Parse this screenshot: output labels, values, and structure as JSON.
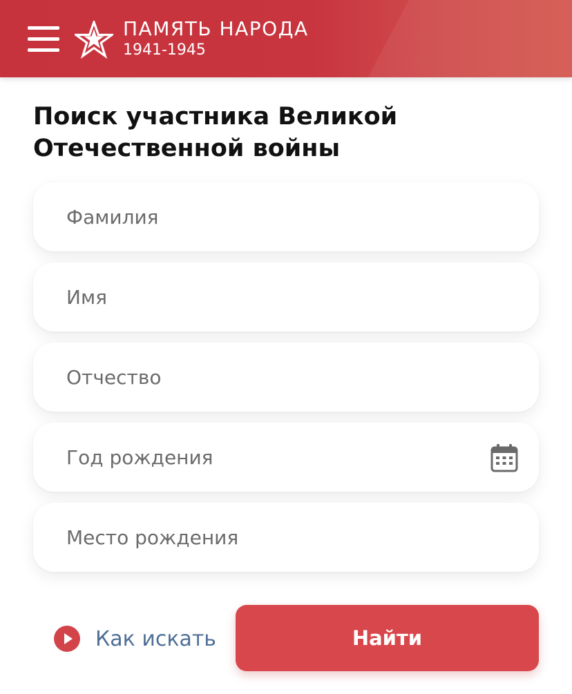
{
  "header": {
    "brand_title": "ПАМЯТЬ НАРОДА",
    "brand_years": "1941-1945",
    "color": "#c7333d"
  },
  "page": {
    "title_line1": "Поиск участника Великой",
    "title_line2": "Отечественной войны"
  },
  "form": {
    "fields": [
      {
        "placeholder": "Фамилия",
        "value": ""
      },
      {
        "placeholder": "Имя",
        "value": ""
      },
      {
        "placeholder": "Отчество",
        "value": ""
      },
      {
        "placeholder": "Год рождения",
        "value": "",
        "icon": "calendar-icon"
      },
      {
        "placeholder": "Место рождения",
        "value": ""
      }
    ],
    "help_link": "Как искать",
    "help_icon": "play-icon",
    "submit_label": "Найти",
    "accent": "#d8474b",
    "link_color": "#4f6f96"
  }
}
